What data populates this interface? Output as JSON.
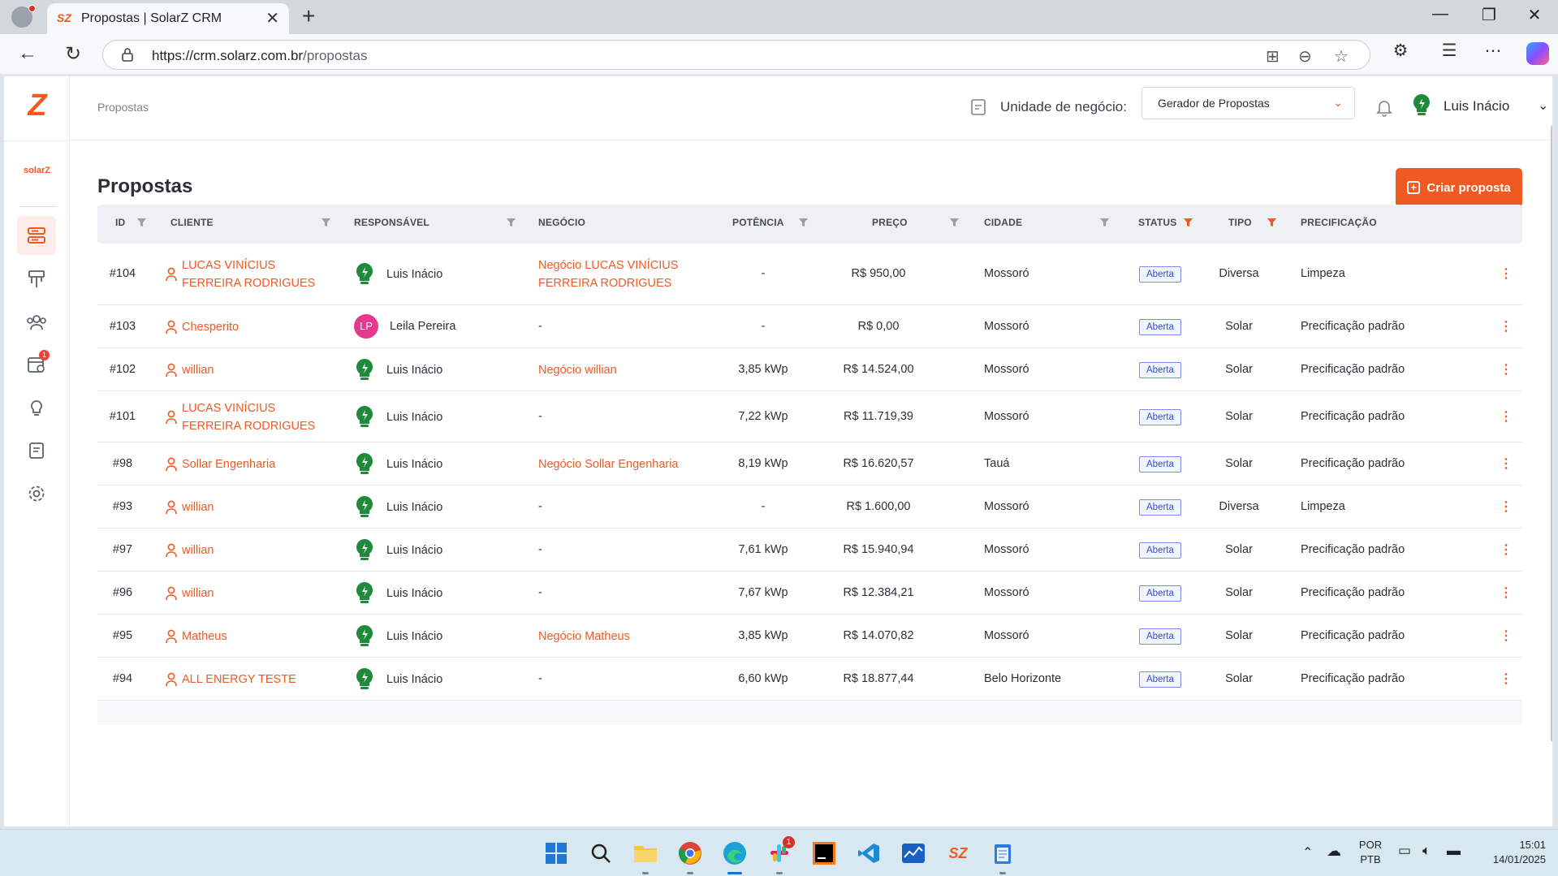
{
  "browser": {
    "tab_title": "Propostas | SolarZ CRM",
    "tab_favicon": "SZ",
    "url_host": "https://crm.solarz.com.br",
    "url_path": "/propostas"
  },
  "app": {
    "brand_small": "solarZ",
    "logo": "Z",
    "sidebar_icons": [
      "proposals-icon",
      "funnel-icon",
      "people-icon",
      "calendar-icon",
      "lightbulb-icon",
      "notes-icon",
      "settings-icon"
    ],
    "calendar_badge": "1",
    "accent_color": "#f05a22"
  },
  "topbar": {
    "breadcrumb": "Propostas",
    "unit_label": "Unidade de negócio:",
    "unit_value": "Gerador de Propostas",
    "user_name": "Luis Inácio"
  },
  "page": {
    "title": "Propostas",
    "create_button": "Criar proposta"
  },
  "table": {
    "columns": {
      "id": "ID",
      "client": "CLIENTE",
      "responsible": "RESPONSÁVEL",
      "business": "NEGÓCIO",
      "power": "POTÊNCIA",
      "price": "PREÇO",
      "city": "CIDADE",
      "status": "STATUS",
      "type": "TIPO",
      "pricing": "PRECIFICAÇÃO"
    },
    "rows": [
      {
        "id": "#104",
        "client": "LUCAS VINÍCIUS FERREIRA RODRIGUES",
        "client_lines": [
          "LUCAS VINÍCIUS",
          "FERREIRA RODRIGUES"
        ],
        "responsible": "Luis Inácio",
        "resp_avatar": "bulb",
        "business_lines": [
          "Negócio LUCAS VINÍCIUS",
          "FERREIRA RODRIGUES"
        ],
        "power": "-",
        "price": "R$ 950,00",
        "city": "Mossoró",
        "status": "Aberta",
        "type": "Diversa",
        "pricing": "Limpeza"
      },
      {
        "id": "#103",
        "client_lines": [
          "Chesperito"
        ],
        "responsible": "Leila Pereira",
        "resp_avatar": "LP",
        "business_lines": [
          "-"
        ],
        "power": "-",
        "price": "R$ 0,00",
        "city": "Mossoró",
        "status": "Aberta",
        "type": "Solar",
        "pricing": "Precificação padrão"
      },
      {
        "id": "#102",
        "client_lines": [
          "willian"
        ],
        "responsible": "Luis Inácio",
        "resp_avatar": "bulb",
        "business_lines": [
          "Negócio willian"
        ],
        "power": "3,85 kWp",
        "price": "R$ 14.524,00",
        "city": "Mossoró",
        "status": "Aberta",
        "type": "Solar",
        "pricing": "Precificação padrão"
      },
      {
        "id": "#101",
        "client_lines": [
          "LUCAS VINÍCIUS",
          "FERREIRA RODRIGUES"
        ],
        "responsible": "Luis Inácio",
        "resp_avatar": "bulb",
        "business_lines": [
          "-"
        ],
        "power": "7,22 kWp",
        "price": "R$ 11.719,39",
        "city": "Mossoró",
        "status": "Aberta",
        "type": "Solar",
        "pricing": "Precificação padrão"
      },
      {
        "id": "#98",
        "client_lines": [
          "Sollar Engenharia"
        ],
        "responsible": "Luis Inácio",
        "resp_avatar": "bulb",
        "business_lines": [
          "Negócio Sollar Engenharia"
        ],
        "power": "8,19 kWp",
        "price": "R$ 16.620,57",
        "city": "Tauá",
        "status": "Aberta",
        "type": "Solar",
        "pricing": "Precificação padrão"
      },
      {
        "id": "#93",
        "client_lines": [
          "willian"
        ],
        "responsible": "Luis Inácio",
        "resp_avatar": "bulb",
        "business_lines": [
          "-"
        ],
        "power": "-",
        "price": "R$ 1.600,00",
        "city": "Mossoró",
        "status": "Aberta",
        "type": "Diversa",
        "pricing": "Limpeza"
      },
      {
        "id": "#97",
        "client_lines": [
          "willian"
        ],
        "responsible": "Luis Inácio",
        "resp_avatar": "bulb",
        "business_lines": [
          "-"
        ],
        "power": "7,61 kWp",
        "price": "R$ 15.940,94",
        "city": "Mossoró",
        "status": "Aberta",
        "type": "Solar",
        "pricing": "Precificação padrão"
      },
      {
        "id": "#96",
        "client_lines": [
          "willian"
        ],
        "responsible": "Luis Inácio",
        "resp_avatar": "bulb",
        "business_lines": [
          "-"
        ],
        "power": "7,67 kWp",
        "price": "R$ 12.384,21",
        "city": "Mossoró",
        "status": "Aberta",
        "type": "Solar",
        "pricing": "Precificação padrão"
      },
      {
        "id": "#95",
        "client_lines": [
          "Matheus"
        ],
        "responsible": "Luis Inácio",
        "resp_avatar": "bulb",
        "business_lines": [
          "Negócio Matheus"
        ],
        "power": "3,85 kWp",
        "price": "R$ 14.070,82",
        "city": "Mossoró",
        "status": "Aberta",
        "type": "Solar",
        "pricing": "Precificação padrão"
      },
      {
        "id": "#94",
        "client_lines": [
          "ALL ENERGY TESTE"
        ],
        "responsible": "Luis Inácio",
        "resp_avatar": "bulb",
        "business_lines": [
          "-"
        ],
        "power": "6,60 kWp",
        "price": "R$ 18.877,44",
        "city": "Belo Horizonte",
        "status": "Aberta",
        "type": "Solar",
        "pricing": "Precificação padrão"
      }
    ]
  },
  "taskbar": {
    "apps": [
      "windows-start-icon",
      "search-icon",
      "file-explorer-icon",
      "chrome-icon",
      "edge-icon",
      "slack-icon",
      "jetbrains-icon",
      "vscode-icon",
      "stocks-icon",
      "solarz-icon",
      "notepad-icon"
    ],
    "slack_badge": "1",
    "lang_line1": "POR",
    "lang_line2": "PTB",
    "time": "15:01",
    "date": "14/01/2025"
  }
}
